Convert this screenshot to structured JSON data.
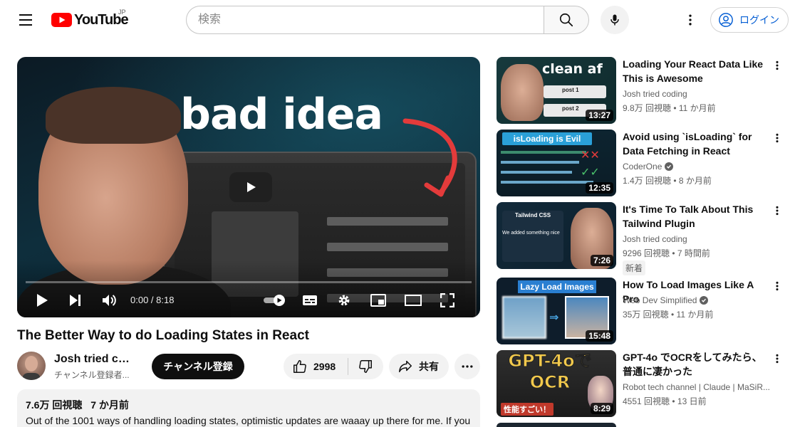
{
  "header": {
    "logo_text": "YouTube",
    "logo_country": "JP",
    "search_placeholder": "検索",
    "login_label": "ログイン"
  },
  "player": {
    "thumbnail_headline": "bad idea",
    "current_time": "0:00",
    "duration": "8:18",
    "time_display": "0:00 / 8:18"
  },
  "video": {
    "title": "The Better Way to do Loading States in React",
    "channel_name": "Josh tried co...",
    "channel_subscribers": "チャンネル登録者...",
    "subscribe_label": "チャンネル登録",
    "like_count": "2998",
    "share_label": "共有",
    "views": "7.6万 回視聴",
    "age": "7 か月前",
    "description": "Out of the 1001 ways of handling loading states, optimistic updates are waaay up there for me. If you"
  },
  "recommendations": [
    {
      "title": "Loading Your React Data Like This is Awesome",
      "channel": "Josh tried coding",
      "verified": false,
      "meta": "9.8万 回視聴 • 11 か月前",
      "duration": "13:27",
      "thumb_text": "clean af",
      "thumb_sub": [
        "post 1",
        "post 2"
      ]
    },
    {
      "title": "Avoid using `isLoading` for Data Fetching in React",
      "channel": "CoderOne",
      "verified": true,
      "meta": "1.4万 回視聴 • 8 か月前",
      "duration": "12:35",
      "thumb_text": "isLoading is Evil"
    },
    {
      "title": "It's Time To Talk About This Tailwind Plugin",
      "channel": "Josh tried coding",
      "verified": false,
      "meta": "9296 回視聴 • 7 時間前",
      "badge": "新着",
      "duration": "7:26",
      "thumb_text": "Tailwind CSS",
      "thumb_sub": [
        "We added something nice"
      ]
    },
    {
      "title": "How To Load Images Like A Pro",
      "channel": "Web Dev Simplified",
      "verified": true,
      "meta": "35万 回視聴 • 11 か月前",
      "duration": "15:48",
      "thumb_text": "Lazy Load Images"
    },
    {
      "title": "GPT-4o でOCRをしてみたら、普通に凄かった",
      "channel": "Robot tech channel | Claude | MaSiR...",
      "verified": false,
      "meta": "4551 回視聴 • 13 日前",
      "duration": "8:29",
      "thumb_text": "GPT-4oで OCR",
      "thumb_sub": [
        "性能すごい！"
      ]
    }
  ],
  "colors": {
    "brand_red": "#ff0000",
    "link_blue": "#065fd4",
    "subscribe_bg": "#0f0f0f",
    "chip_bg": "#f2f2f2"
  }
}
